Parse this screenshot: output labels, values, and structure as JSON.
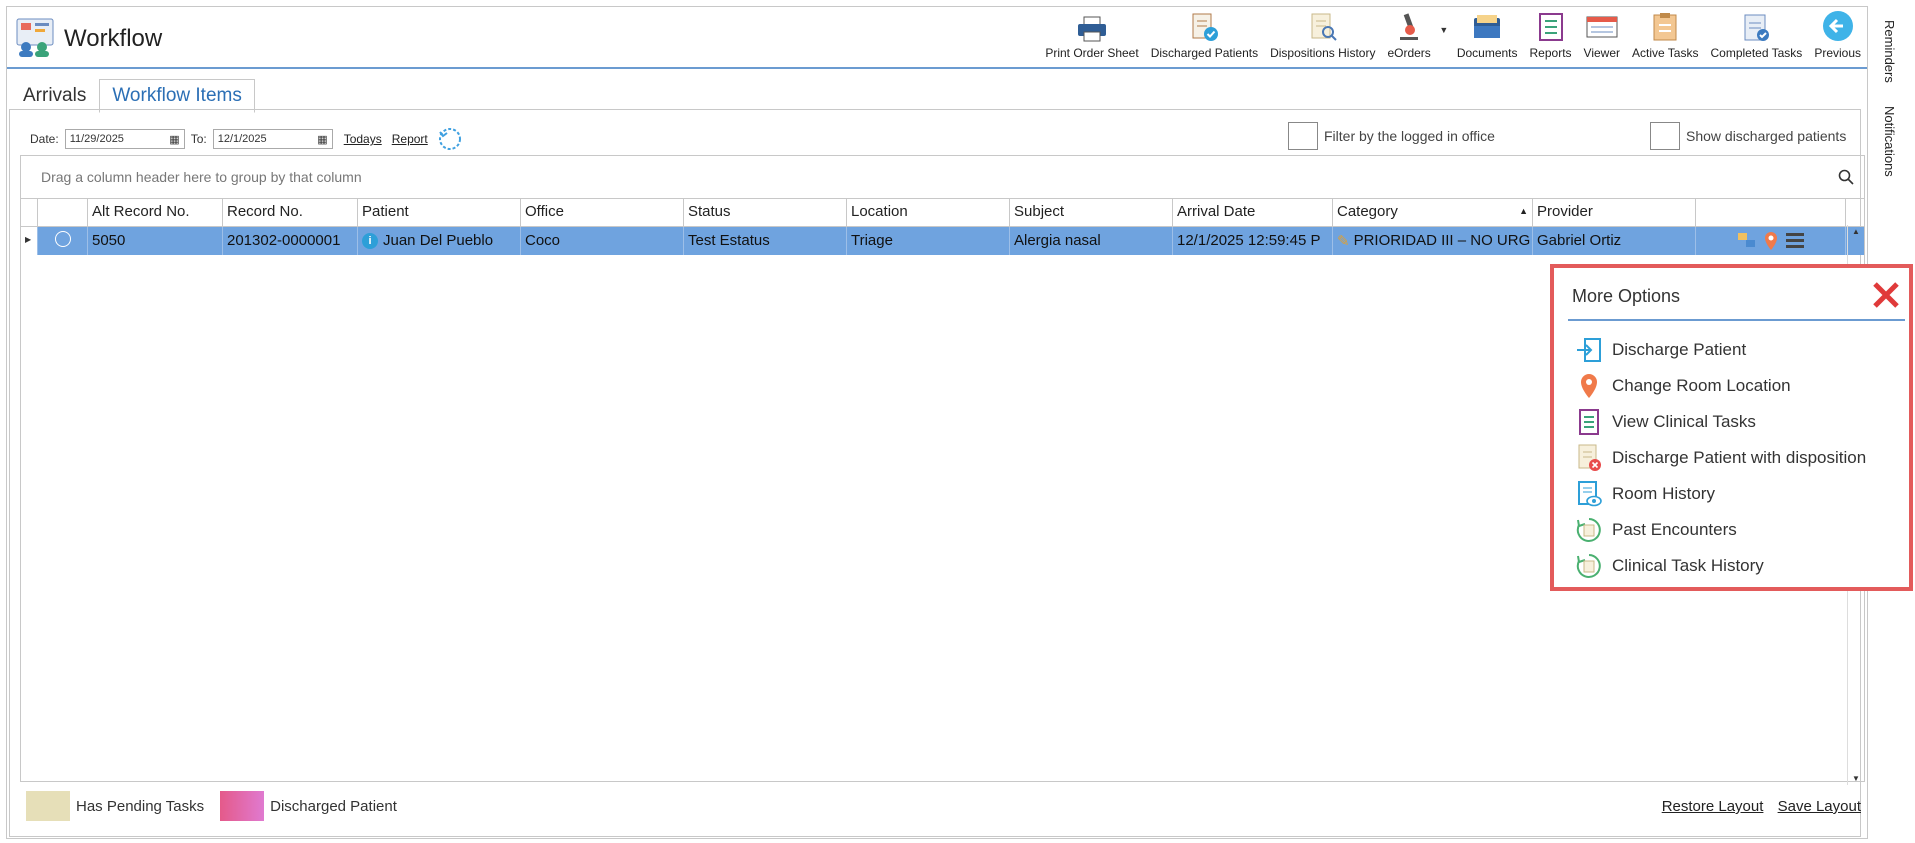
{
  "app": {
    "title": "Workflow"
  },
  "toolbar": [
    {
      "label": "Print Order Sheet",
      "icon": "printer-icon"
    },
    {
      "label": "Discharged Patients",
      "icon": "discharged-patients-icon"
    },
    {
      "label": "Dispositions History",
      "icon": "dispositions-history-icon"
    },
    {
      "label": "eOrders",
      "icon": "microscope-icon"
    },
    {
      "label": "Documents",
      "icon": "documents-icon"
    },
    {
      "label": "Reports",
      "icon": "reports-icon"
    },
    {
      "label": "Viewer",
      "icon": "viewer-icon"
    },
    {
      "label": "Active Tasks",
      "icon": "active-tasks-icon"
    },
    {
      "label": "Completed Tasks",
      "icon": "completed-tasks-icon"
    },
    {
      "label": "Previous",
      "icon": "back-arrow-icon"
    }
  ],
  "side_tabs": {
    "reminders": "Reminders",
    "notifications": "Notifications"
  },
  "tabs": {
    "arrivals": "Arrivals",
    "workflow_items": "Workflow Items"
  },
  "filter": {
    "date_label": "Date:",
    "date_from": "11/29/2025",
    "to_label": "To:",
    "date_to": "12/1/2025",
    "todays": "Todays",
    "report": "Report",
    "filter_office": "Filter by the logged in office",
    "show_discharged": "Show discharged patients"
  },
  "grid": {
    "group_hint": "Drag a column header here to group by that column",
    "columns": {
      "alt_record": "Alt Record No.",
      "record": "Record No.",
      "patient": "Patient",
      "office": "Office",
      "status": "Status",
      "location": "Location",
      "subject": "Subject",
      "arrival": "Arrival Date",
      "category": "Category",
      "provider": "Provider"
    },
    "rows": [
      {
        "alt_record": "5050",
        "record": "201302-0000001",
        "patient": "Juan Del Pueblo",
        "office": "Coco",
        "status": "Test Estatus",
        "location": "Triage",
        "subject": "Alergia nasal",
        "arrival": "12/1/2025 12:59:45 P",
        "category": "PRIORIDAD III – NO URG",
        "provider": "Gabriel Ortiz"
      }
    ]
  },
  "legend": {
    "pending": "Has Pending Tasks",
    "pending_color": "#e6dfb8",
    "discharged": "Discharged Patient",
    "discharged_color": "#e46aa0"
  },
  "layout_links": {
    "restore": "Restore Layout",
    "save": "Save Layout"
  },
  "popup": {
    "title": "More Options",
    "options": [
      "Discharge Patient",
      "Change Room Location",
      "View Clinical Tasks",
      "Discharge Patient with disposition",
      "Room History",
      "Past Encounters",
      "Clinical Task History"
    ]
  }
}
